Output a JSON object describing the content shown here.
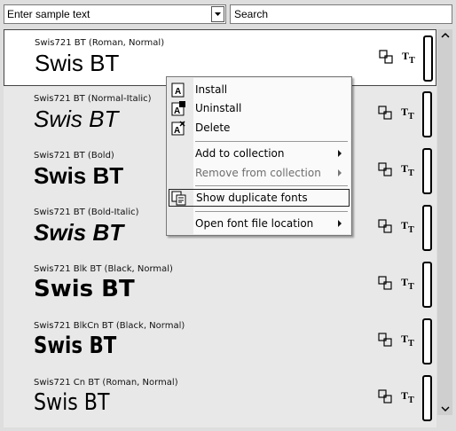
{
  "toolbar": {
    "sample_text_placeholder": "Enter sample text",
    "search_placeholder": "Search"
  },
  "fonts": [
    {
      "name": "Swis721 BT (Roman, Normal)",
      "sample": "Swis BT",
      "style": "roman",
      "selected": true
    },
    {
      "name": "Swis721 BT (Normal-Italic)",
      "sample": "Swis BT",
      "style": "italic"
    },
    {
      "name": "Swis721 BT (Bold)",
      "sample": "Swis BT",
      "style": "bold"
    },
    {
      "name": "Swis721 BT (Bold-Italic)",
      "sample": "Swis BT",
      "style": "bolditalic"
    },
    {
      "name": "Swis721 Blk BT (Black, Normal)",
      "sample": "Swis BT",
      "style": "black"
    },
    {
      "name": "Swis721 BlkCn BT (Black, Normal)",
      "sample": "Swis BT",
      "style": "blackcn"
    },
    {
      "name": "Swis721 Cn BT (Roman, Normal)",
      "sample": "Swis BT",
      "style": "cn"
    }
  ],
  "context_menu": {
    "items": [
      {
        "label": "Install",
        "icon": "install-icon"
      },
      {
        "label": "Uninstall",
        "icon": "uninstall-icon"
      },
      {
        "label": "Delete",
        "icon": "delete-icon"
      },
      {
        "label": "Add to collection",
        "submenu": true
      },
      {
        "label": "Remove from collection",
        "submenu": true,
        "disabled": true
      },
      {
        "label": "Show duplicate fonts",
        "icon": "duplicate-fonts-icon",
        "highlighted": true
      },
      {
        "label": "Open font file location",
        "submenu": true
      }
    ]
  }
}
